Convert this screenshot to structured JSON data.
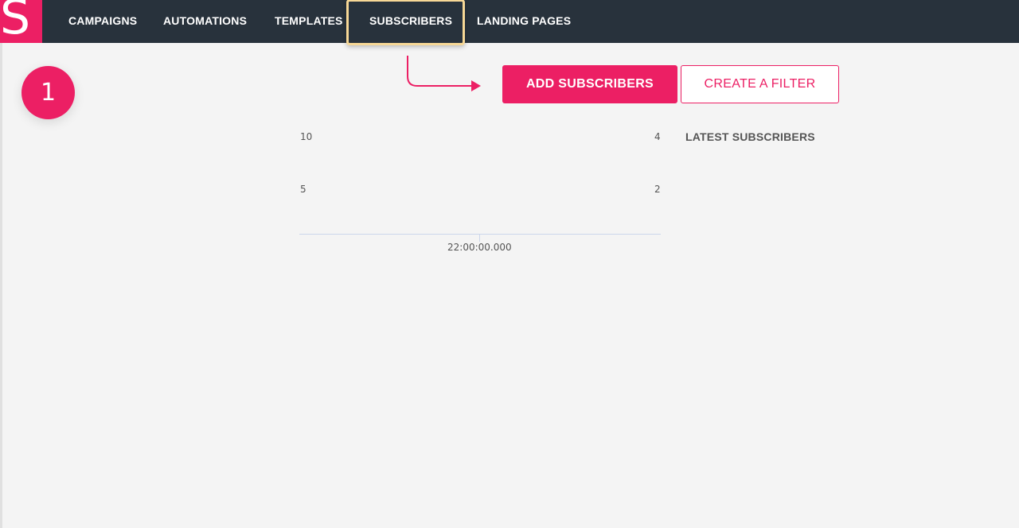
{
  "brand": {
    "logo_letter": "S",
    "accent_color": "#ec1f64",
    "nav_bg_color": "#28323c",
    "highlight_color": "#f7d896"
  },
  "nav": {
    "items": [
      {
        "label": "CAMPAIGNS"
      },
      {
        "label": "AUTOMATIONS"
      },
      {
        "label": "TEMPLATES"
      },
      {
        "label": "SUBSCRIBERS",
        "active": true
      },
      {
        "label": "LANDING PAGES"
      }
    ]
  },
  "tutorial": {
    "step_number": "1"
  },
  "actions": {
    "add_label": "ADD SUBSCRIBERS",
    "filter_label": "CREATE A FILTER"
  },
  "chart": {
    "left_axis_ticks": [
      "10",
      "5"
    ],
    "right_axis_ticks": [
      "4",
      "2"
    ],
    "x_tick": "22:00:00.000"
  },
  "latest": {
    "title": "LATEST SUBSCRIBERS"
  }
}
